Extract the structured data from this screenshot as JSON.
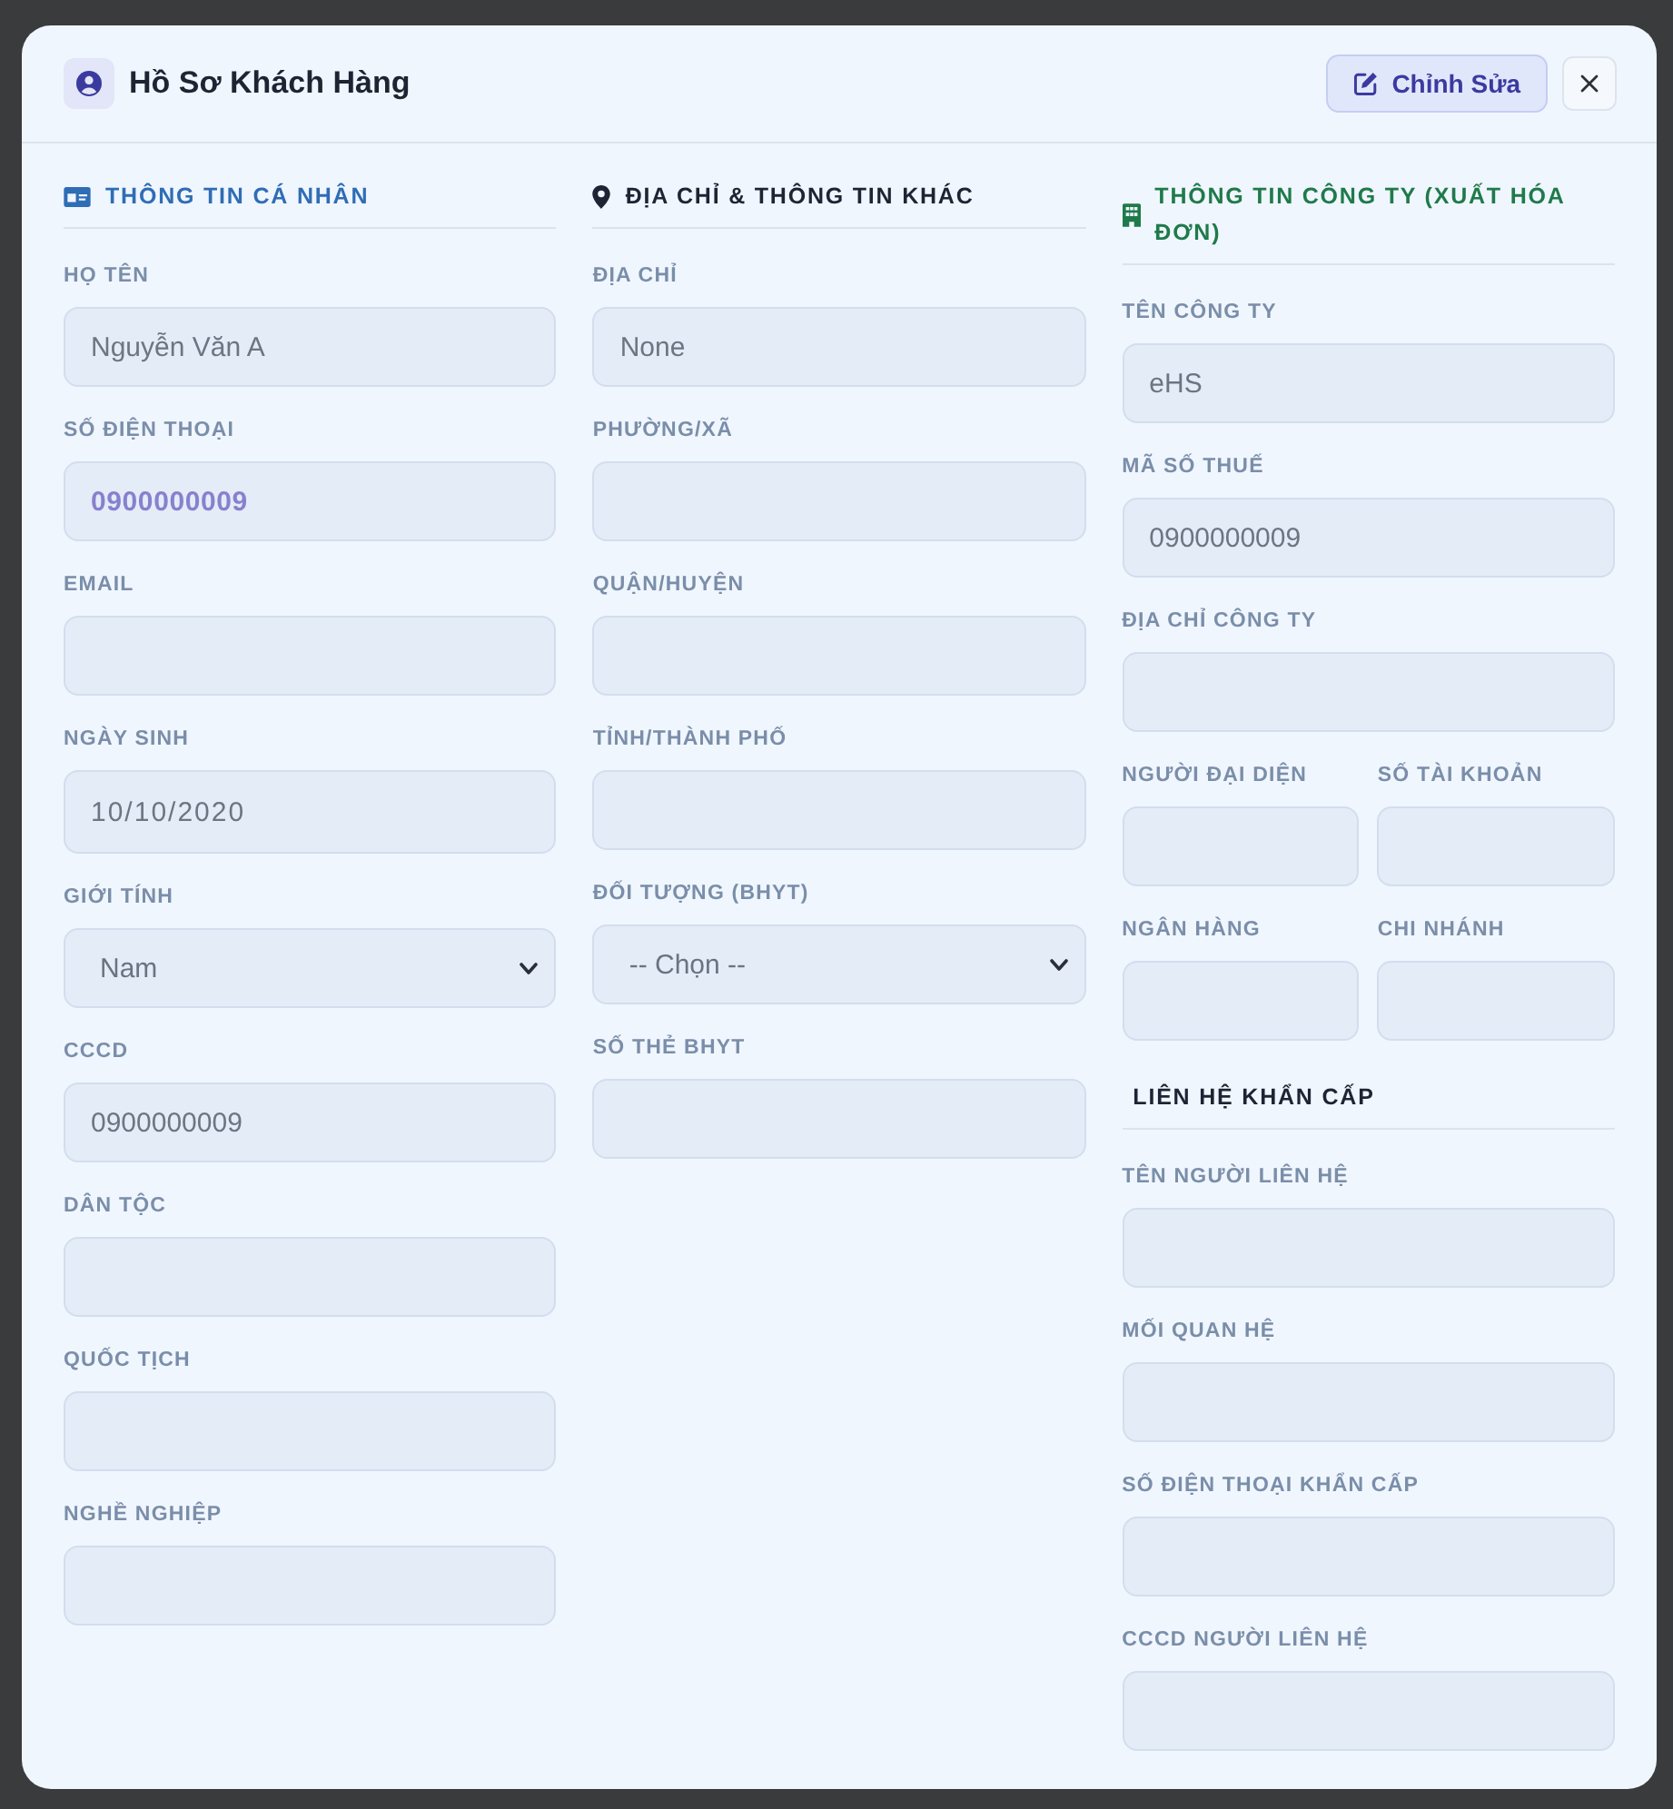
{
  "header": {
    "title": "Hồ Sơ Khách Hàng",
    "edit_button": "Chỉnh Sửa"
  },
  "columns": [
    {
      "sections": [
        {
          "title": "THÔNG TIN CÁ NHÂN",
          "color": "#2f6db5",
          "fields": [
            {
              "kind": "input",
              "label": "HỌ TÊN",
              "value": "Nguyễn Văn A"
            },
            {
              "kind": "phone",
              "label": "SỐ ĐIỆN THOẠI",
              "value": "0900000009"
            },
            {
              "kind": "input",
              "label": "EMAIL"
            },
            {
              "kind": "date",
              "label": "NGÀY SINH",
              "value": "10/10/2020"
            },
            {
              "kind": "select",
              "label": "GIỚI TÍNH",
              "value": "Nam"
            },
            {
              "kind": "input",
              "label": "CCCD",
              "value": "0900000009"
            },
            {
              "kind": "input",
              "label": "DÂN TỘC"
            },
            {
              "kind": "input",
              "label": "QUỐC TỊCH"
            },
            {
              "kind": "input",
              "label": "NGHỀ NGHIỆP"
            }
          ]
        }
      ]
    },
    {
      "sections": [
        {
          "title": "ĐỊA CHỈ & THÔNG TIN KHÁC",
          "color": "#1e2433",
          "fields": [
            {
              "kind": "input",
              "label": "ĐỊA CHỈ",
              "value": "None"
            },
            {
              "kind": "input",
              "label": "PHƯỜNG/XÃ"
            },
            {
              "kind": "input",
              "label": "QUẬN/HUYỆN"
            },
            {
              "kind": "input",
              "label": "TỈNH/THÀNH PHỐ"
            },
            {
              "kind": "select",
              "label": "ĐỐI TƯỢNG (BHYT)",
              "value": "-- Chọn --"
            },
            {
              "kind": "input",
              "label": "SỐ THẺ BHYT"
            }
          ]
        }
      ]
    },
    {
      "sections": [
        {
          "title": "THÔNG TIN CÔNG TY (XUẤT HÓA ĐƠN)",
          "color": "#1f7a4a",
          "fields": [
            {
              "kind": "input",
              "label": "TÊN CÔNG TY",
              "value": "eHS"
            },
            {
              "kind": "input",
              "label": "MÃ SỐ THUẾ",
              "value": "0900000009"
            },
            {
              "kind": "input",
              "label": "ĐỊA CHỈ CÔNG TY"
            },
            {
              "kind": "pair",
              "fields": [
                {
                  "kind": "input",
                  "label": "NGƯỜI ĐẠI DIỆN"
                },
                {
                  "kind": "input",
                  "label": "SỐ TÀI KHOẢN"
                }
              ]
            },
            {
              "kind": "pair",
              "fields": [
                {
                  "kind": "input",
                  "label": "NGÂN HÀNG"
                },
                {
                  "kind": "input",
                  "label": "CHI NHÁNH"
                }
              ]
            }
          ]
        },
        {
          "title": "LIÊN HỆ KHẨN CẤP",
          "color": "#1e2433",
          "fields": [
            {
              "kind": "input",
              "label": "TÊN NGƯỜI LIÊN HỆ"
            },
            {
              "kind": "input",
              "label": "MỐI QUAN HỆ"
            },
            {
              "kind": "input",
              "label": "SỐ ĐIỆN THOẠI KHẨN CẤP"
            },
            {
              "kind": "input",
              "label": "CCCD NGƯỜI LIÊN HỆ"
            }
          ]
        }
      ]
    }
  ]
}
